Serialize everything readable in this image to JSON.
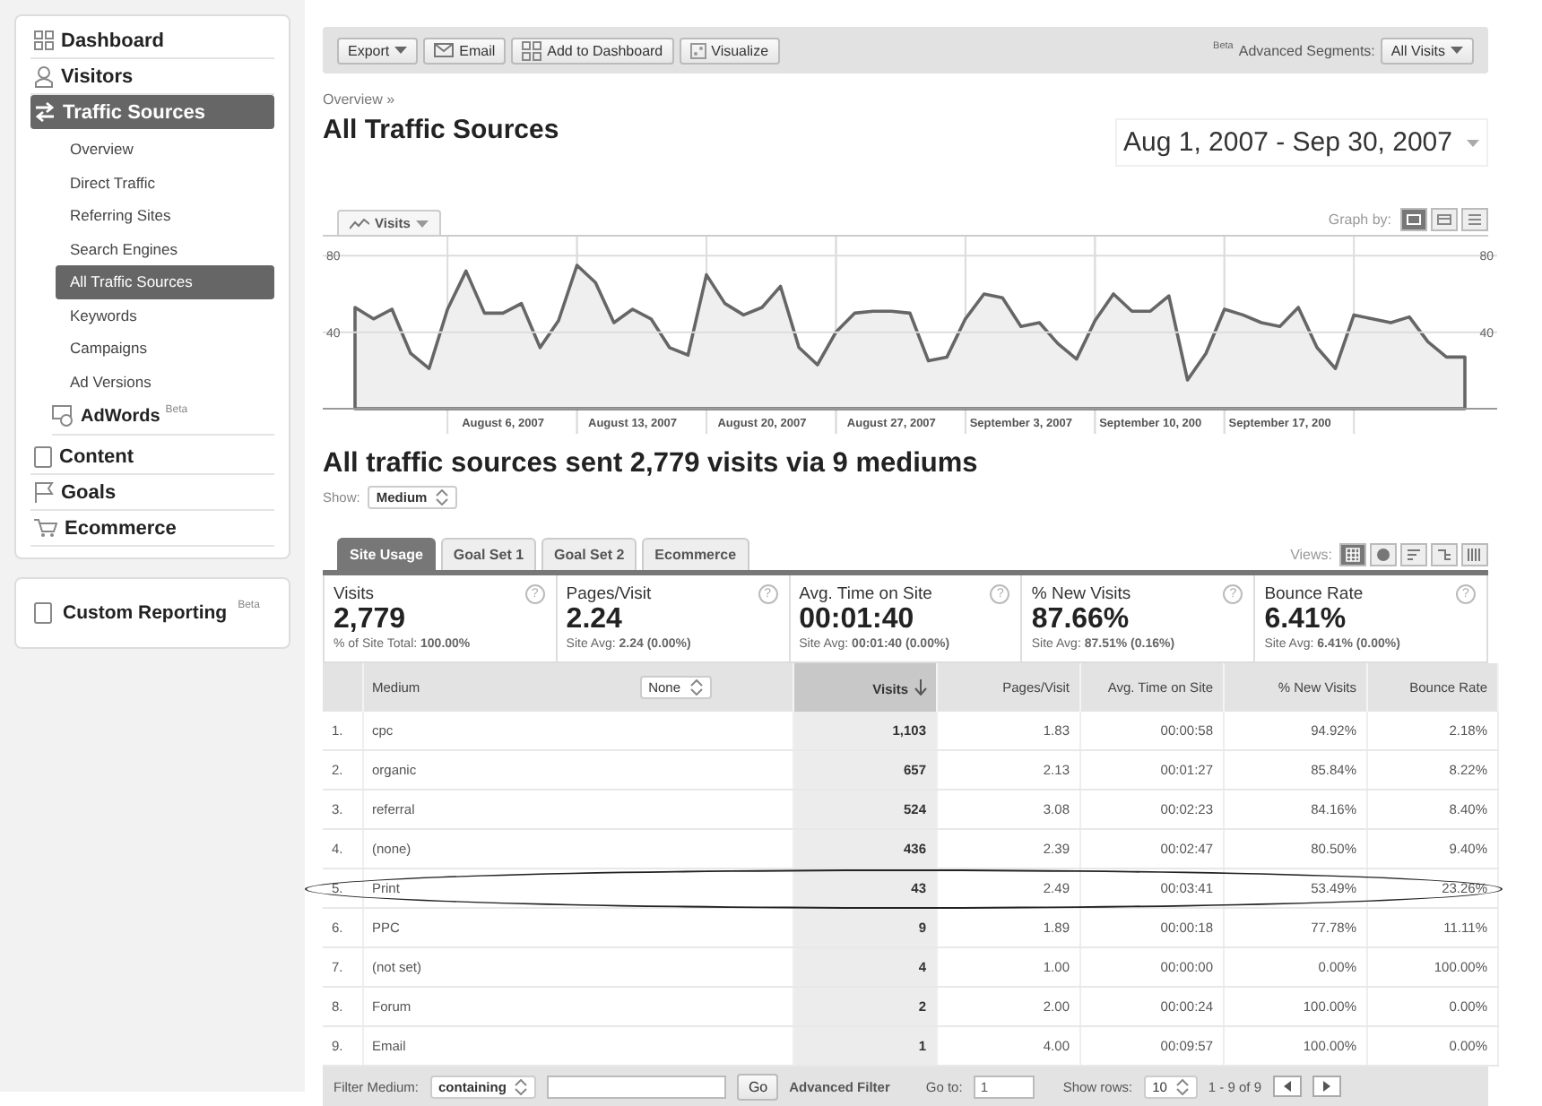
{
  "sidebar": {
    "items": [
      {
        "label": "Dashboard",
        "selected": false
      },
      {
        "label": "Visitors",
        "selected": false
      },
      {
        "label": "Traffic Sources",
        "selected": true,
        "children": [
          {
            "label": "Overview",
            "kind": "link",
            "selected": false
          },
          {
            "label": "Direct Traffic",
            "kind": "link",
            "selected": false
          },
          {
            "label": "Referring Sites",
            "kind": "link",
            "selected": false
          },
          {
            "label": "Search Engines",
            "kind": "link",
            "selected": false
          },
          {
            "label": "All Traffic Sources",
            "kind": "link",
            "selected": true
          },
          {
            "label": "Keywords",
            "kind": "link",
            "selected": false
          },
          {
            "label": "Campaigns",
            "kind": "link",
            "selected": false
          },
          {
            "label": "Ad Versions",
            "kind": "link",
            "selected": false
          },
          {
            "label": "AdWords",
            "badge": "Beta",
            "kind": "group",
            "selected": false
          }
        ]
      },
      {
        "label": "Content",
        "selected": false
      },
      {
        "label": "Goals",
        "selected": false
      },
      {
        "label": "Ecommerce",
        "selected": false
      }
    ],
    "custom_reporting": {
      "label": "Custom Reporting",
      "badge": "Beta"
    }
  },
  "toolbar": {
    "buttons": [
      {
        "label": "Export",
        "kind": "dropdown"
      },
      {
        "label": "Email",
        "kind": "mail"
      },
      {
        "label": "Add to Dashboard",
        "kind": "grid"
      },
      {
        "label": "Visualize",
        "kind": "motion"
      }
    ],
    "segments_badge": "Beta",
    "segments_label": "Advanced Segments:",
    "segments_value": "All Visits"
  },
  "breadcrumb": "Overview »",
  "title": "All Traffic Sources",
  "date_range": "Aug 1, 2007 - Sep 30, 2007",
  "chart": {
    "graph_by_label": "Graph by:",
    "graph_by": [
      {
        "selected": true
      },
      {
        "selected": false
      },
      {
        "selected": false
      }
    ],
    "left_axis_labels": [
      "80",
      "40"
    ],
    "right_axis_labels": [
      "80",
      "40"
    ],
    "chart_data": {
      "type": "area",
      "grid": true,
      "ylim": [
        0,
        90
      ],
      "yticks": [
        40,
        80
      ],
      "categories": [
        null,
        null,
        null,
        null,
        null,
        null,
        null,
        null,
        "August 6, 2007",
        null,
        null,
        null,
        null,
        null,
        null,
        "August 13, 2007",
        null,
        null,
        null,
        null,
        null,
        null,
        "August 20, 2007",
        null,
        null,
        null,
        null,
        null,
        null,
        "August 27, 2007",
        null,
        null,
        null,
        null,
        null,
        null,
        "September 3, 2007",
        null,
        null,
        null,
        null,
        null,
        null,
        "September 10, 200",
        null,
        null,
        null,
        null,
        null,
        null,
        "September 17, 200",
        null,
        null,
        null,
        null,
        null,
        null,
        null,
        null,
        null,
        null
      ],
      "series": [
        {
          "name": "Visits",
          "color": "#666666",
          "values": [
            53,
            47,
            52,
            29,
            21,
            52,
            72,
            50,
            50,
            55,
            32,
            46,
            75,
            66,
            45,
            52,
            47,
            32,
            28,
            70,
            55,
            49,
            53,
            64,
            32,
            23,
            40,
            50,
            51,
            51,
            50,
            25,
            27,
            47,
            60,
            58,
            43,
            45,
            34,
            26,
            46,
            60,
            51,
            51,
            59,
            15,
            29,
            52,
            49,
            45,
            43,
            53,
            32,
            21,
            49,
            47,
            45,
            48,
            35,
            27,
            27
          ]
        }
      ]
    }
  },
  "summary_title": "All traffic sources sent 2,779 visits via 9 mediums",
  "show": {
    "label": "Show:",
    "value": "Medium"
  },
  "report_tabs": [
    {
      "label": "Site Usage",
      "selected": true
    },
    {
      "label": "Goal Set 1",
      "selected": false
    },
    {
      "label": "Goal Set 2",
      "selected": false
    },
    {
      "label": "Ecommerce",
      "selected": false
    }
  ],
  "views_label": "Views:",
  "views": [
    {
      "selected": true
    },
    {
      "selected": false
    },
    {
      "selected": false
    },
    {
      "selected": false
    },
    {
      "selected": false
    }
  ],
  "metrics": [
    {
      "label": "Visits",
      "help": "?",
      "value": "2,779",
      "note": "% of Site Total: **100.00%**"
    },
    {
      "label": "Pages/Visit",
      "help": "?",
      "value": "2.24",
      "note": "Site Avg: **2.24 (0.00%)**"
    },
    {
      "label": "Avg. Time on Site",
      "help": "?",
      "value": "00:01:40",
      "note": "Site Avg: **00:01:40 (0.00%)**"
    },
    {
      "label": "% New Visits",
      "help": "?",
      "value": "87.66%",
      "note": "Site Avg: **87.51% (0.16%)**"
    },
    {
      "label": "Bounce Rate",
      "help": "?",
      "value": "6.41%",
      "note": "Site Avg: **6.41% (0.00%)**"
    }
  ],
  "table": {
    "segment_value": "None",
    "columns": [
      {
        "sorted": false
      },
      {
        "label": "Medium",
        "sorted": false
      },
      {
        "label": "Visits",
        "sorted": true
      },
      {
        "label": "Pages/Visit",
        "sorted": false
      },
      {
        "label": "Avg. Time on Site",
        "sorted": false
      },
      {
        "label": "% New Visits",
        "sorted": false
      },
      {
        "label": "Bounce Rate",
        "sorted": false
      }
    ],
    "rows": [
      {
        "cells": [
          "1.",
          "cpc",
          "1,103",
          "1.83",
          "00:00:58",
          "94.92%",
          "2.18%"
        ],
        "circled": false
      },
      {
        "cells": [
          "2.",
          "organic",
          "657",
          "2.13",
          "00:01:27",
          "85.84%",
          "8.22%"
        ],
        "circled": false
      },
      {
        "cells": [
          "3.",
          "referral",
          "524",
          "3.08",
          "00:02:23",
          "84.16%",
          "8.40%"
        ],
        "circled": false
      },
      {
        "cells": [
          "4.",
          "(none)",
          "436",
          "2.39",
          "00:02:47",
          "80.50%",
          "9.40%"
        ],
        "circled": false
      },
      {
        "cells": [
          "5.",
          "Print",
          "43",
          "2.49",
          "00:03:41",
          "53.49%",
          "23.26%"
        ],
        "circled": true
      },
      {
        "cells": [
          "6.",
          "PPC",
          "9",
          "1.89",
          "00:00:18",
          "77.78%",
          "11.11%"
        ],
        "circled": false
      },
      {
        "cells": [
          "7.",
          "(not set)",
          "4",
          "1.00",
          "00:00:00",
          "0.00%",
          "100.00%"
        ],
        "circled": false
      },
      {
        "cells": [
          "8.",
          "Forum",
          "2",
          "2.00",
          "00:00:24",
          "100.00%",
          "0.00%"
        ],
        "circled": false
      },
      {
        "cells": [
          "9.",
          "Email",
          "1",
          "4.00",
          "00:09:57",
          "100.00%",
          "0.00%"
        ],
        "circled": false
      }
    ]
  },
  "footer": {
    "filter_label": "Filter Medium:",
    "filter_mode": "containing",
    "go": "Go",
    "advanced": "Advanced Filter",
    "goto_label": "Go to:",
    "goto_value": "1",
    "rows_label": "Show rows:",
    "rows_value": "10",
    "range": "1 - 9 of 9"
  }
}
